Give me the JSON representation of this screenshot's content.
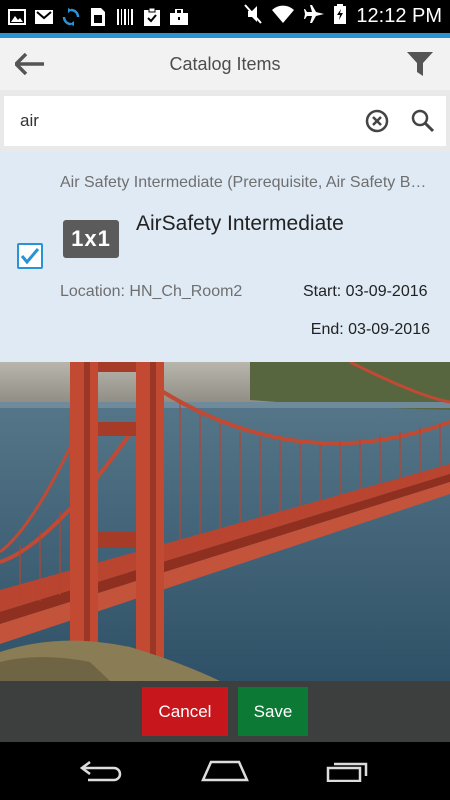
{
  "status_bar": {
    "time": "12:12 PM",
    "left_icons": [
      "image-icon",
      "gmail-icon",
      "sync-icon",
      "sim-icon",
      "barcode-icon",
      "clipboard-check-icon",
      "briefcase-icon"
    ],
    "right_icons": [
      "mute-icon",
      "wifi-icon",
      "airplane-icon",
      "battery-icon"
    ]
  },
  "colors": {
    "accent": "#2a93d5",
    "cancel": "#c8161d",
    "save": "#0c7a35"
  },
  "header": {
    "title": "Catalog Items"
  },
  "search": {
    "value": "air",
    "placeholder": ""
  },
  "item": {
    "subtitle": "Air Safety Intermediate (Prerequisite, Air Safety Basics)",
    "badge": "1x1",
    "title": "AirSafety Intermediate",
    "location": "Location: HN_Ch_Room2",
    "start": "Start: 03-09-2016",
    "end": "End: 03-09-2016",
    "checked": true
  },
  "actions": {
    "cancel_label": "Cancel",
    "save_label": "Save"
  }
}
